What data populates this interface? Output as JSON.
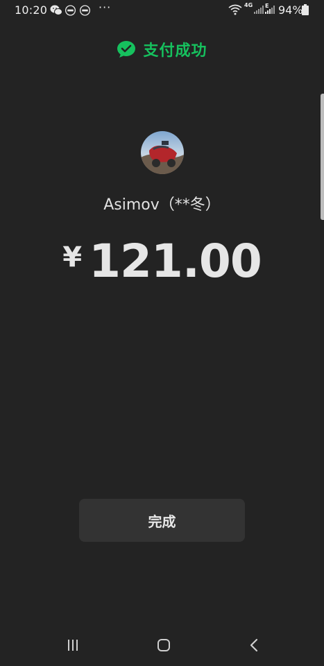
{
  "status_bar": {
    "time": "10:20",
    "more": "···",
    "network_4g": "4G",
    "network_e": "E",
    "battery_percent": "94%",
    "notification_icons": [
      "wechat-icon",
      "idm-icon",
      "idm-icon"
    ],
    "status_icons": [
      "wifi-icon",
      "signal-icon",
      "signal-icon",
      "battery-icon"
    ]
  },
  "header": {
    "title": "支付成功",
    "accent_color": "#16c15e"
  },
  "payee": {
    "name": "Asimov（**冬）"
  },
  "payment": {
    "currency_symbol": "¥",
    "amount": "121.00"
  },
  "actions": {
    "done_label": "完成"
  },
  "nav_bar": {
    "buttons": [
      "recent-apps-icon",
      "home-icon",
      "back-icon"
    ]
  },
  "colors": {
    "background": "#232323",
    "button": "#333333",
    "text": "#e6e6e6"
  }
}
